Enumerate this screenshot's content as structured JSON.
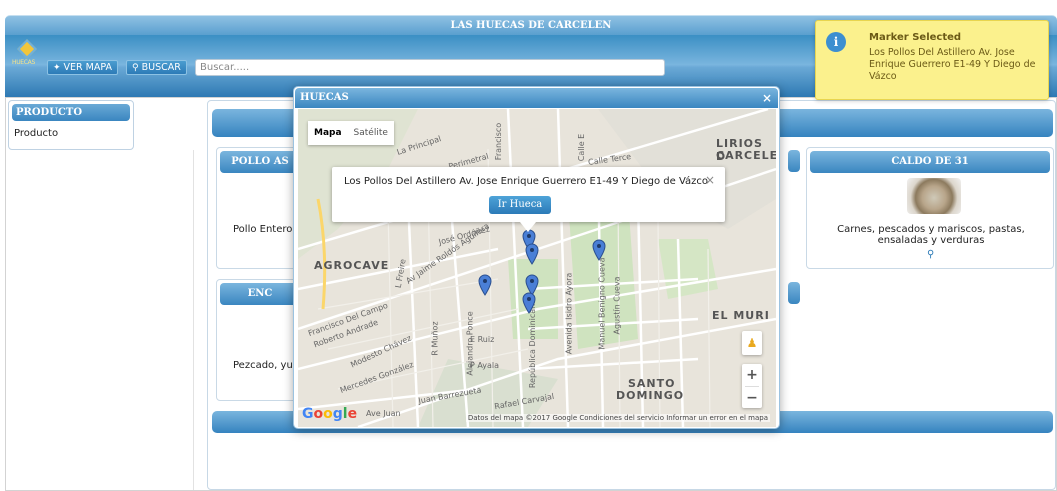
{
  "app": {
    "title": "LAS HUECAS DE CARCELEN",
    "logo_text": "HUECAS"
  },
  "toolbar": {
    "ver_mapa": "VER MAPA",
    "buscar": "BUSCAR",
    "search_placeholder": "Buscar....."
  },
  "sidebar": {
    "header": "PRODUCTO",
    "items": [
      "Producto"
    ]
  },
  "cards": [
    {
      "title": "POLLO AS",
      "text": "Pollo Entero"
    },
    {
      "title": "CALDO DE 31",
      "text": "Carnes, pescados y mariscos, pastas, ensaladas y verduras"
    },
    {
      "title": "ENC",
      "text": "Pezcado, yu"
    }
  ],
  "dialog": {
    "title": "HUECAS",
    "close": "×",
    "map_type": {
      "map": "Mapa",
      "satellite": "Satélite"
    },
    "info": {
      "text": "Los Pollos Del Astillero Av. Jose Enrique Guerrero E1-49 Y Diego de Vázco",
      "button": "Ir Hueca",
      "close": "×"
    },
    "place_labels": [
      "LIRIOS D",
      "CARCELE",
      "AGROCAVE",
      "EL MURI",
      "SANTO",
      "DOMINGO"
    ],
    "streets": [
      "La Principal",
      "Perimetral",
      "Calle Terce",
      "José Ordóñez",
      "Av Jaime Roldós Aguilera",
      "Francisco Del Campo",
      "Roberto Andrade",
      "Modesto Chávez",
      "Mercedes González",
      "Juan Barrezueta",
      "Rafael Carvajal",
      "P Ayala",
      "E Ruiz",
      "R Muñoz",
      "Alejandro Ponce",
      "República Dominicana",
      "Avenida Isidro Ayora",
      "Manuel Benigno Cueva",
      "Agustín Cueva",
      "Francisco",
      "L Freire",
      "Calle E",
      "Ave Juan"
    ],
    "google": "Google",
    "attribution": "Datos del mapa ©2017 Google   Condiciones del servicio   Informar un error en el mapa",
    "zoom_in": "+",
    "zoom_out": "−"
  },
  "notification": {
    "title": "Marker Selected",
    "text": "Los Pollos Del Astillero Av. Jose Enrique Guerrero E1-49 Y Diego de Vázco",
    "icon": "i"
  },
  "colors": {
    "accent": "#3a86c0",
    "notification_bg": "#fbf18d",
    "marker": "#4a7fd6"
  },
  "icons": {
    "ver_mapa": "pin-icon",
    "buscar": "search-icon",
    "info": "info-icon"
  }
}
